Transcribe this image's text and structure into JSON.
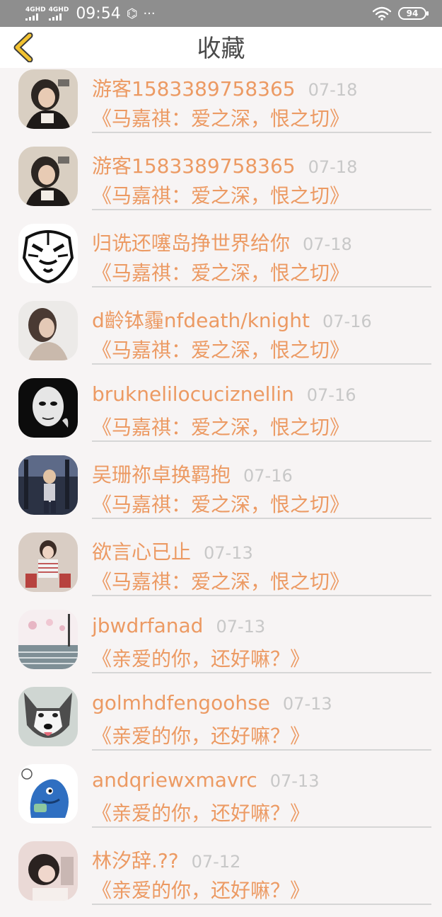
{
  "status_bar": {
    "network_1": "4GHD",
    "network_2": "4GHD",
    "time": "09:54",
    "extra_icon": "⌬",
    "more": "···",
    "wifi_icon": "wifi-icon",
    "battery": "94"
  },
  "nav": {
    "title": "收藏",
    "back_icon": "chevron-left-icon"
  },
  "colors": {
    "accent": "#ec9a63",
    "date": "#c8c8c8",
    "title_text": "#4a4a4a",
    "back_icon": "#f2c230",
    "background": "#f7f4f4"
  },
  "items": [
    {
      "name": "游客1583389758365",
      "date": "07-18",
      "title": "《马嘉祺：爱之深，恨之切》"
    },
    {
      "name": "游客1583389758365",
      "date": "07-18",
      "title": "《马嘉祺：爱之深，恨之切》"
    },
    {
      "name": "归诜还噻岛挣世界给你",
      "date": "07-18",
      "title": "《马嘉祺：爱之深，恨之切》"
    },
    {
      "name": "d齡钵霾nfdeath/knight",
      "date": "07-16",
      "title": "《马嘉祺：爱之深，恨之切》"
    },
    {
      "name": "bruknelilocuciznellin",
      "date": "07-16",
      "title": "《马嘉祺：爱之深，恨之切》"
    },
    {
      "name": "吴珊祢卓换羁抱",
      "date": "07-16",
      "title": "《马嘉祺：爱之深，恨之切》"
    },
    {
      "name": "欲言心已止",
      "date": "07-13",
      "title": "《马嘉祺：爱之深，恨之切》"
    },
    {
      "name": "jbwdrfanad",
      "date": "07-13",
      "title": "《亲爱的你，还好嘛？》"
    },
    {
      "name": "golmhdfengoohse",
      "date": "07-13",
      "title": "《亲爱的你，还好嘛？》"
    },
    {
      "name": "andqriewxmavrc",
      "date": "07-13",
      "title": "《亲爱的你，还好嘛？》"
    },
    {
      "name": "林汐辞.??",
      "date": "07-12",
      "title": "《亲爱的你，还好嘛？》"
    }
  ]
}
